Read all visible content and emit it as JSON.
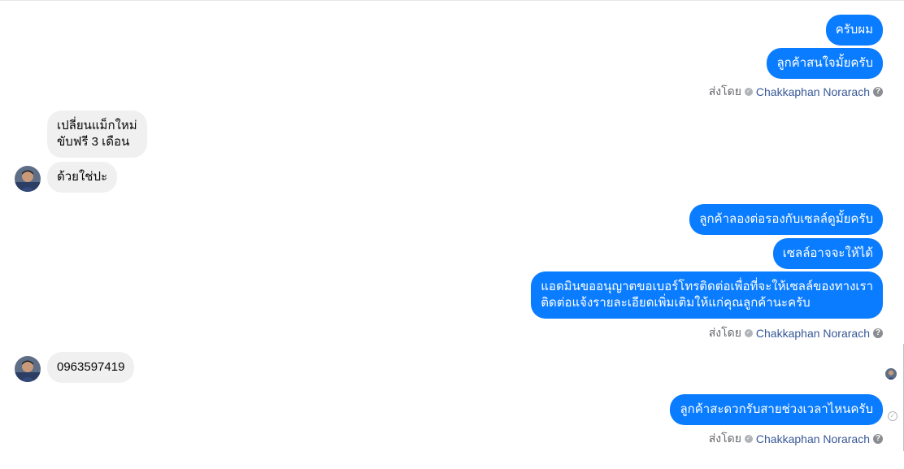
{
  "messages_outgoing_group1": [
    "ครับผม",
    "ลูกค้าสนใจมั้ยครับ"
  ],
  "sent_by": {
    "prefix": "ส่งโดย",
    "name": "Chakkaphan Norarach"
  },
  "messages_incoming_group1": [
    "เปลี่ยนแม็กใหม่\nขับฟรี 3 เดือน",
    "ด้วยใช่ปะ"
  ],
  "messages_outgoing_group2": [
    "ลูกค้าลองต่อรองกับเซลล์ดูมั้ยครับ",
    "เซลล์อาจจะให้ได้",
    "แอดมินขออนุญาตขอเบอร์โทรติดต่อเพื่อที่จะให้เซลล์ของทางเรา\nติดต่อแจ้งรายละเอียดเพิ่มเติมให้แก่คุณลูกค้านะครับ"
  ],
  "messages_incoming_group2": [
    "0963597419"
  ],
  "messages_outgoing_group3": [
    "ลูกค้าสะดวกรับสายช่วงเวลาไหนครับ"
  ],
  "icons": {
    "verified": "check-circle-icon",
    "help": "question-icon",
    "delivered": "delivered-check-icon"
  },
  "colors": {
    "outgoing_bubble": "#0a7cff",
    "incoming_bubble": "#f0f0f0",
    "sender_name": "#385898"
  }
}
